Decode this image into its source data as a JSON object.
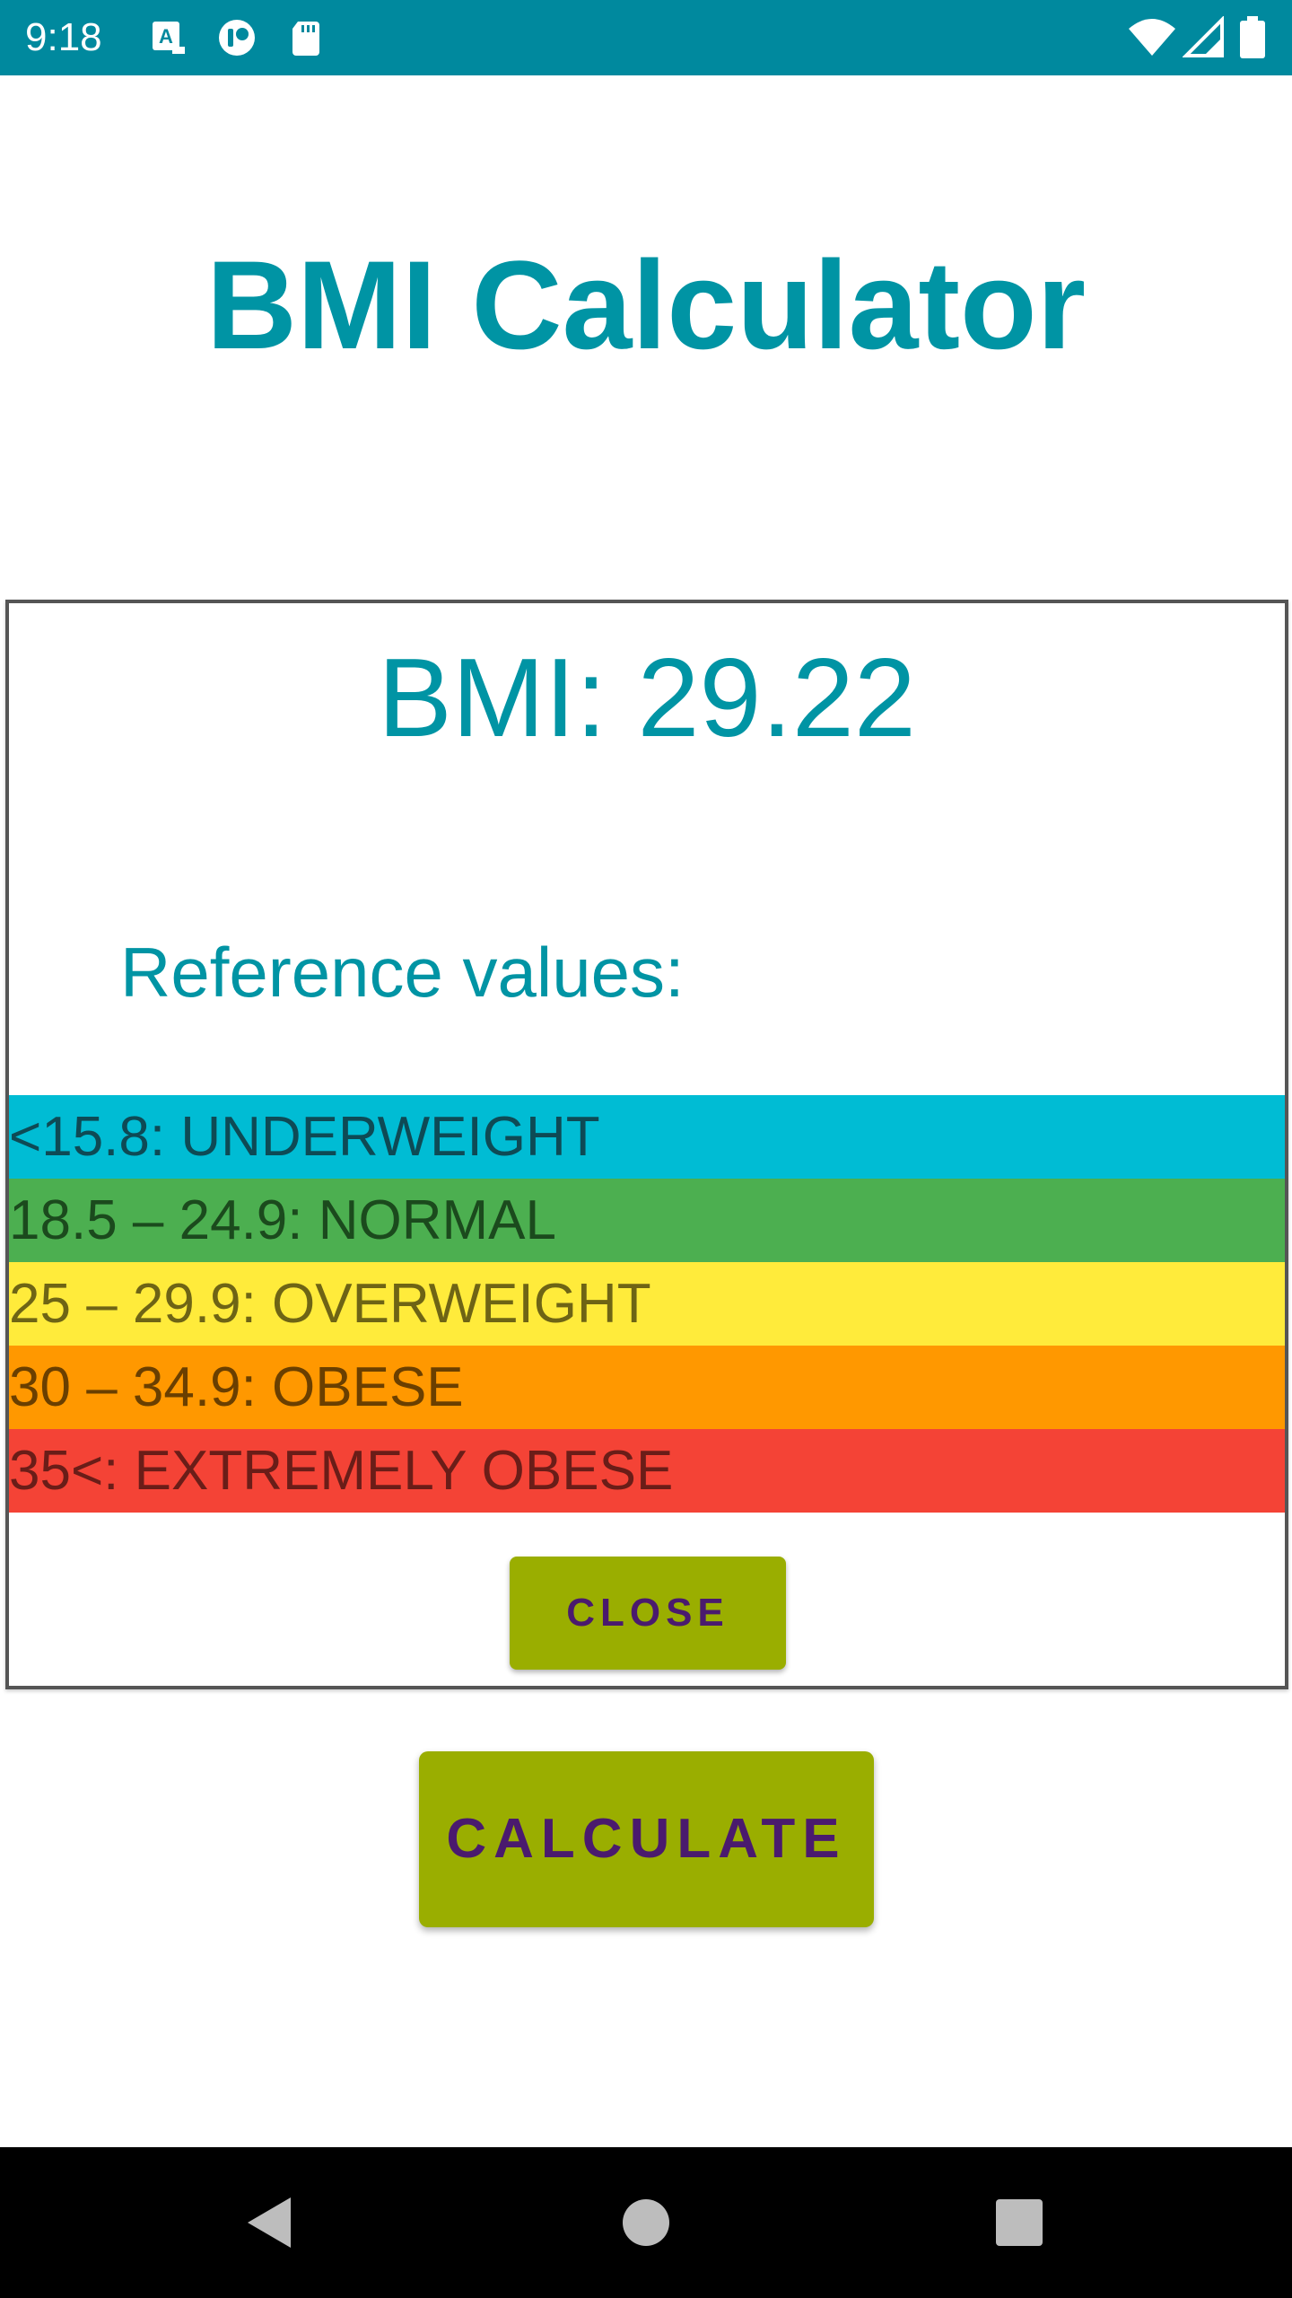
{
  "status_bar": {
    "time": "9:18",
    "background_color": "#00899E",
    "left_icons": [
      "keyboard-a-icon",
      "sync-icon",
      "sd-card-icon"
    ],
    "right_icons": [
      "wifi-icon",
      "signal-icon",
      "battery-icon"
    ]
  },
  "app": {
    "title": "BMI Calculator",
    "accent_color": "#0094A4"
  },
  "dialog": {
    "bmi_text": "BMI: 29.22",
    "reference_heading": "Reference values:",
    "reference_rows": [
      {
        "label": "<15.8: UNDERWEIGHT",
        "bg": "#00BCD4",
        "fg": "#0E4A55"
      },
      {
        "label": "18.5 – 24.9: NORMAL",
        "bg": "#4CAF50",
        "fg": "#1B4A1D"
      },
      {
        "label": "25 – 29.9: OVERWEIGHT",
        "bg": "#FFEB3B",
        "fg": "#6E6415"
      },
      {
        "label": "30 – 34.9: OBESE",
        "bg": "#FF9800",
        "fg": "#6A3F00"
      },
      {
        "label": "35<: EXTREMELY OBESE",
        "bg": "#F44336",
        "fg": "#6A1D18"
      }
    ],
    "close_label": "CLOSE"
  },
  "calculate_label": "CALCULATE",
  "button_color": "#9AAE00",
  "button_text_color": "#4A1A6E",
  "nav_bar": {
    "buttons": [
      "back-icon",
      "home-icon",
      "recents-icon"
    ]
  }
}
